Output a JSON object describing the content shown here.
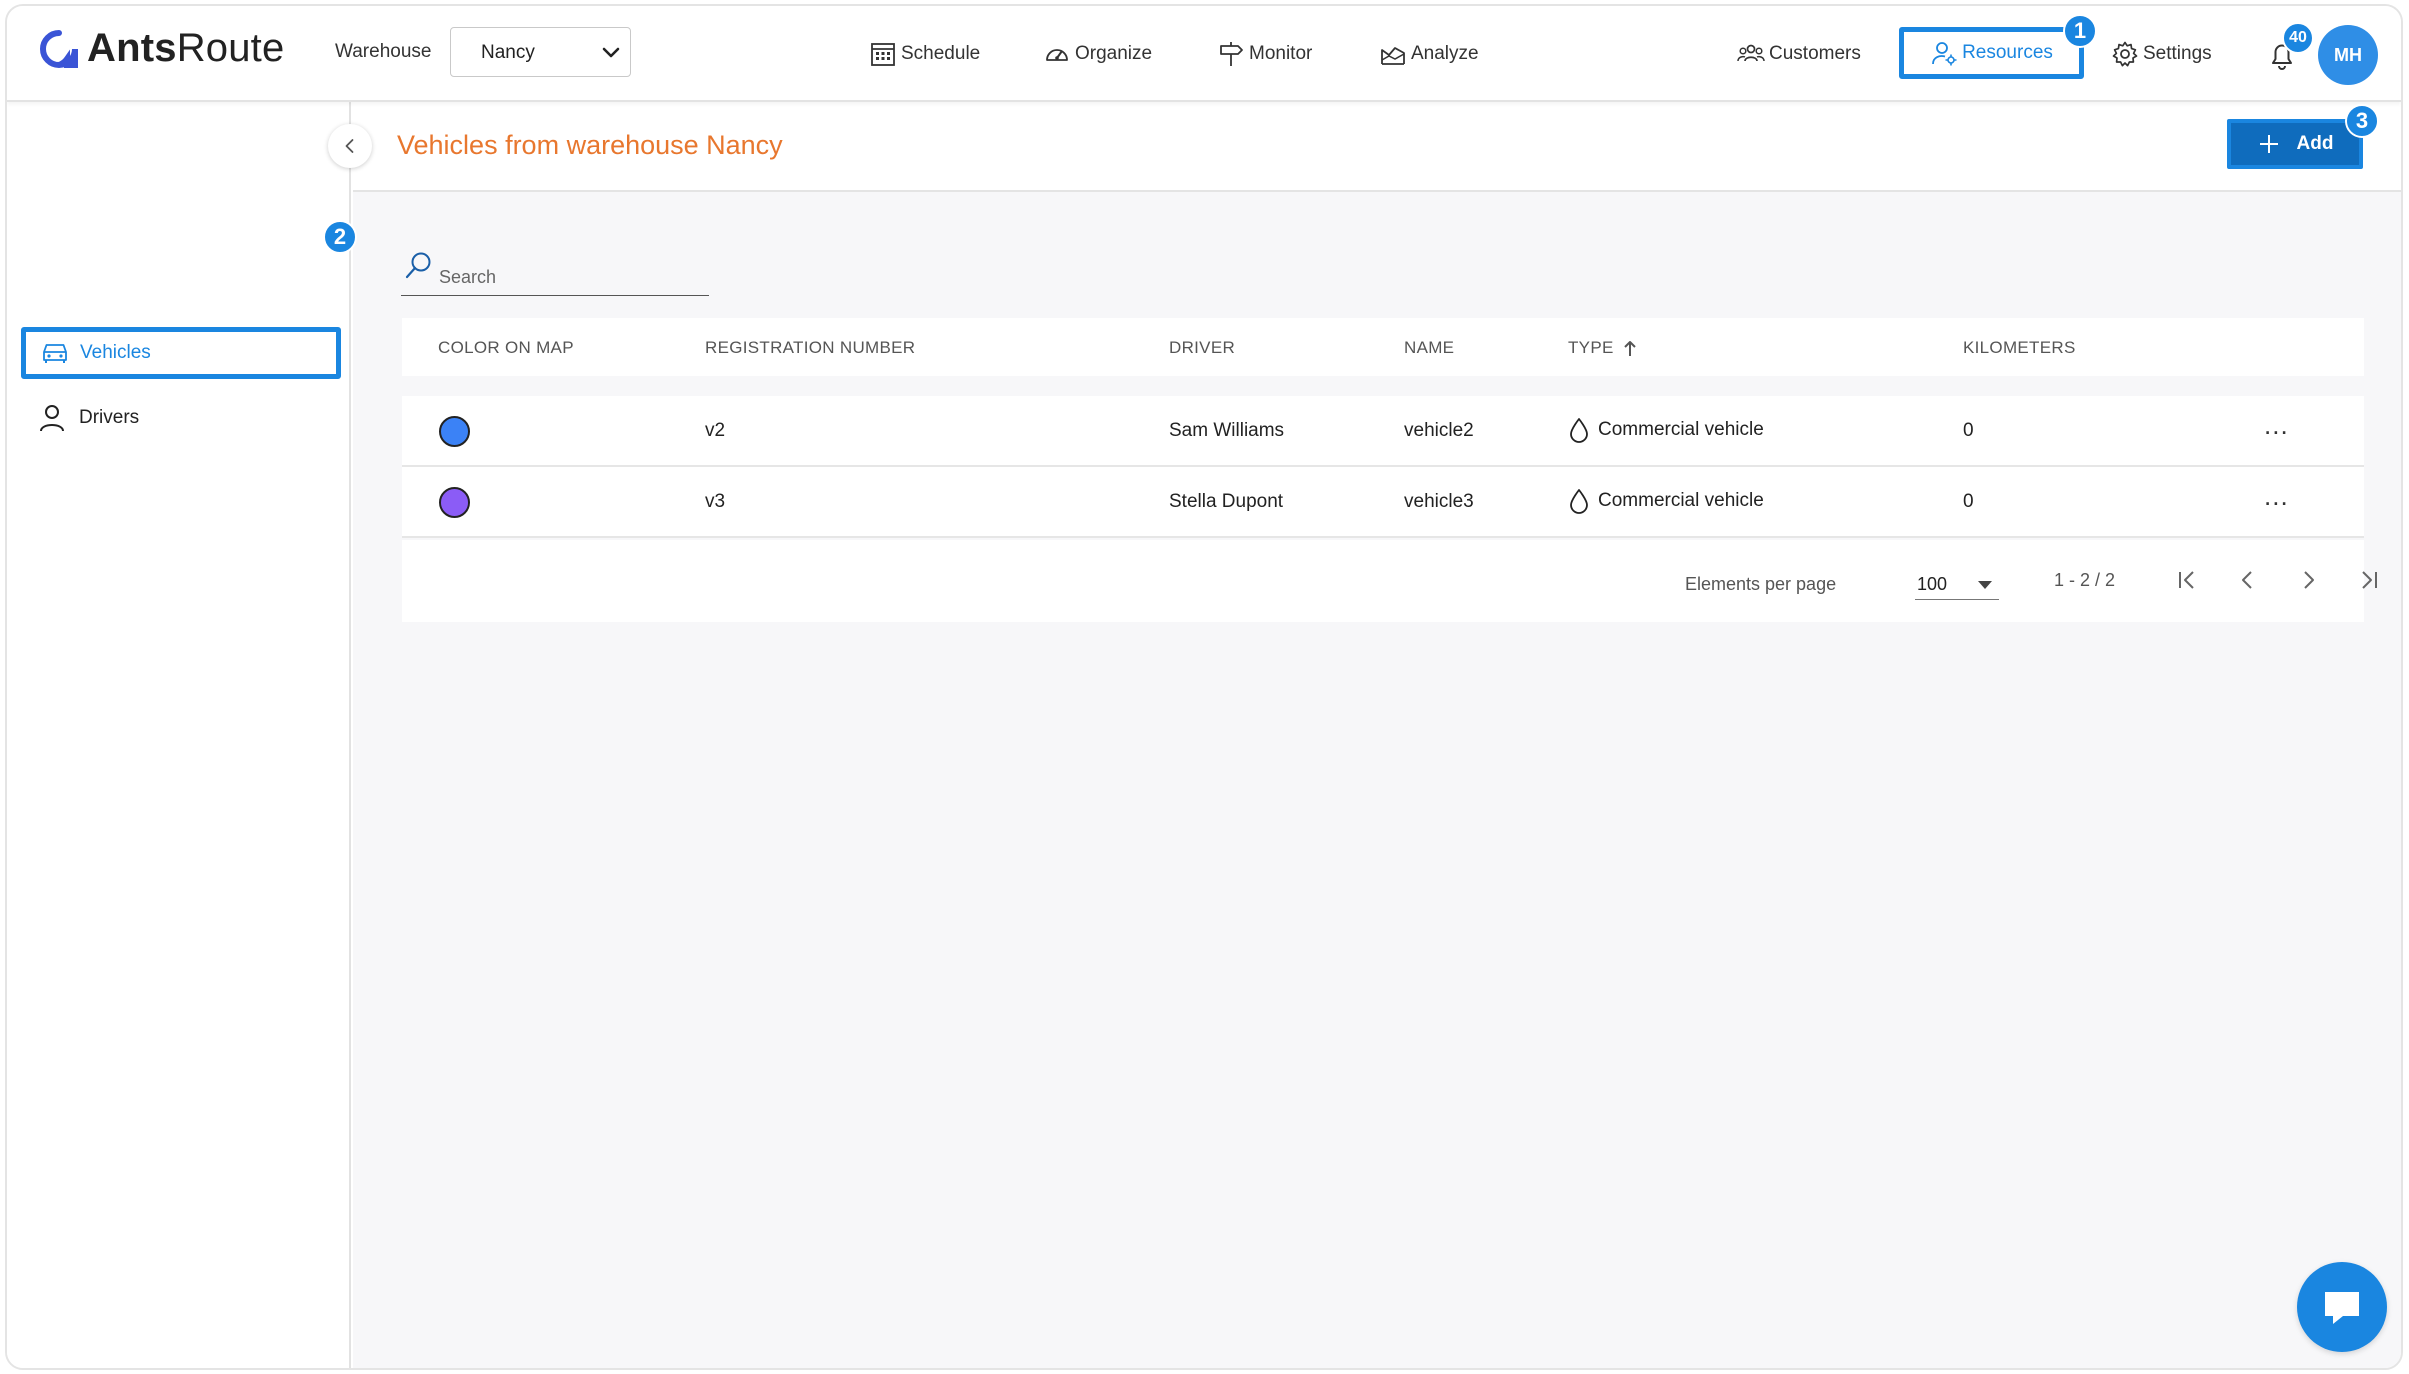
{
  "app": {
    "logo_bold": "Ants",
    "logo_light": "Route"
  },
  "header": {
    "warehouse_label": "Warehouse",
    "warehouse_value": "Nancy",
    "nav": {
      "schedule": "Schedule",
      "organize": "Organize",
      "monitor": "Monitor",
      "analyze": "Analyze",
      "customers": "Customers",
      "resources": "Resources",
      "settings": "Settings"
    },
    "notification_count": "40",
    "avatar_initials": "MH"
  },
  "callouts": [
    "1",
    "2",
    "3"
  ],
  "sidebar": {
    "vehicles": "Vehicles",
    "drivers": "Drivers"
  },
  "page": {
    "title": "Vehicles from warehouse Nancy",
    "add_label": "Add",
    "search_placeholder": "Search"
  },
  "table": {
    "columns": [
      "COLOR ON MAP",
      "REGISTRATION NUMBER",
      "DRIVER",
      "NAME",
      "TYPE",
      "KILOMETERS"
    ],
    "sort_column": "TYPE",
    "sort_direction": "ascending",
    "rows": [
      {
        "color": "#3b82f6",
        "registration": "v2",
        "driver": "Sam Williams",
        "name": "vehicle2",
        "type": "Commercial vehicle",
        "km": "0",
        "actions": "..."
      },
      {
        "color": "#8b5cf6",
        "registration": "v3",
        "driver": "Stella Dupont",
        "name": "vehicle3",
        "type": "Commercial vehicle",
        "km": "0",
        "actions": "..."
      }
    ]
  },
  "pagination": {
    "label": "Elements per page",
    "per_page": "100",
    "range": "1 - 2 / 2"
  },
  "colors": {
    "accent": "#1a86e0",
    "title": "#e8772e",
    "add_button": "#0f6cbd"
  }
}
